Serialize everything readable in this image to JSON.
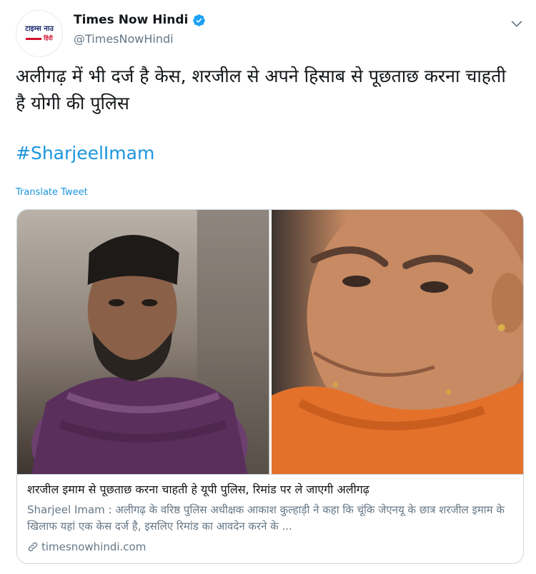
{
  "account": {
    "name": "Times Now Hindi",
    "handle": "@TimesNowHindi",
    "logo_top": "टाइम्स नाउ",
    "logo_sub": "हिंदी",
    "verified": true
  },
  "tweet": {
    "text": "अलीगढ़ में भी दर्ज है केस, शरजील से अपने हिसाब से पूछताछ करना चाहती है योगी की पुलिस",
    "hashtag": "#SharjeelImam",
    "translate_label": "Translate Tweet"
  },
  "card": {
    "title": "शरजील इमाम से पूछताछ करना चाहती हे यूपी पुलिस, रिमांड पर ले जाएगी अलीगढ़",
    "description": "Sharjeel Imam : अलीगढ़ के वरिष्ठ पुलिस अधीक्षक आकाश कुल्हाड़ी ने कहा कि चूंकि जेएनयू के छात्र शरजील इमाम के खिलाफ यहां एक केस दर्ज है, इसलिए रिमांड का आवदेन करने के ...",
    "domain": "timesnowhindi.com",
    "images": [
      "photo-man-in-scarf",
      "photo-man-in-saffron"
    ]
  },
  "colors": {
    "link": "#1b95e0",
    "secondary_text": "#657786",
    "verified": "#1da1f2",
    "border": "#ccd6dd"
  }
}
